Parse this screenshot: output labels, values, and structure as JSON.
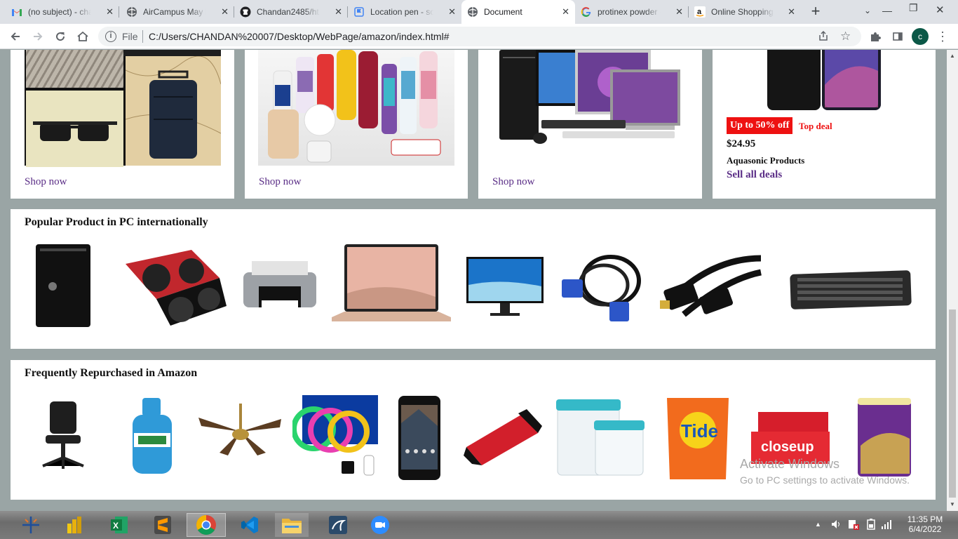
{
  "tabs": [
    {
      "title": "(no subject) - chan",
      "icon": "gmail-icon"
    },
    {
      "title": "AirCampus May Fu",
      "icon": "globe-icon"
    },
    {
      "title": "Chandan2485/html",
      "icon": "github-icon"
    },
    {
      "title": "Location pen - soli",
      "icon": "flag-icon"
    },
    {
      "title": "Document",
      "icon": "globe-icon",
      "active": true
    },
    {
      "title": "protinex powder -",
      "icon": "google-icon"
    },
    {
      "title": "Online Shopping s",
      "icon": "amazon-icon"
    }
  ],
  "browser": {
    "file_label": "File",
    "url": "C:/Users/CHANDAN%20007/Desktop/WebPage/amazon/index.html#",
    "profile_initial": "c"
  },
  "top_cards": {
    "shop_now": "Shop now",
    "deal": {
      "badge": "Up to 50% off",
      "tag": "Top deal",
      "price": "$24.95",
      "product": "Aquasonic Products",
      "link": "Sell all deals"
    }
  },
  "section_pc": {
    "title": "Popular Product in PC internationally",
    "items": [
      "Dell desktop tower",
      "MSI graphics card",
      "HP printer",
      "Laptop",
      "Monitor",
      "VGA cable",
      "HDMI cable",
      "Keyboard"
    ]
  },
  "section_repurchase": {
    "title": "Frequently Repurchased in Amazon",
    "items": [
      "Office chair",
      "Dettol bottle",
      "Ceiling fan",
      "LED strip lights",
      "Smartphone",
      "SanDisk pen drive",
      "Storage containers",
      "Tide detergent",
      "Closeup toothpaste",
      "Protinex junior"
    ]
  },
  "watermark": {
    "line1": "Activate Windows",
    "line2": "Go to PC settings to activate Windows."
  },
  "taskbar": {
    "time": "11:35 PM",
    "date": "6/4/2022"
  },
  "colors": {
    "deal_red": "#e11",
    "link_purple": "#5a2d86",
    "page_bg": "#9aa5a5"
  }
}
